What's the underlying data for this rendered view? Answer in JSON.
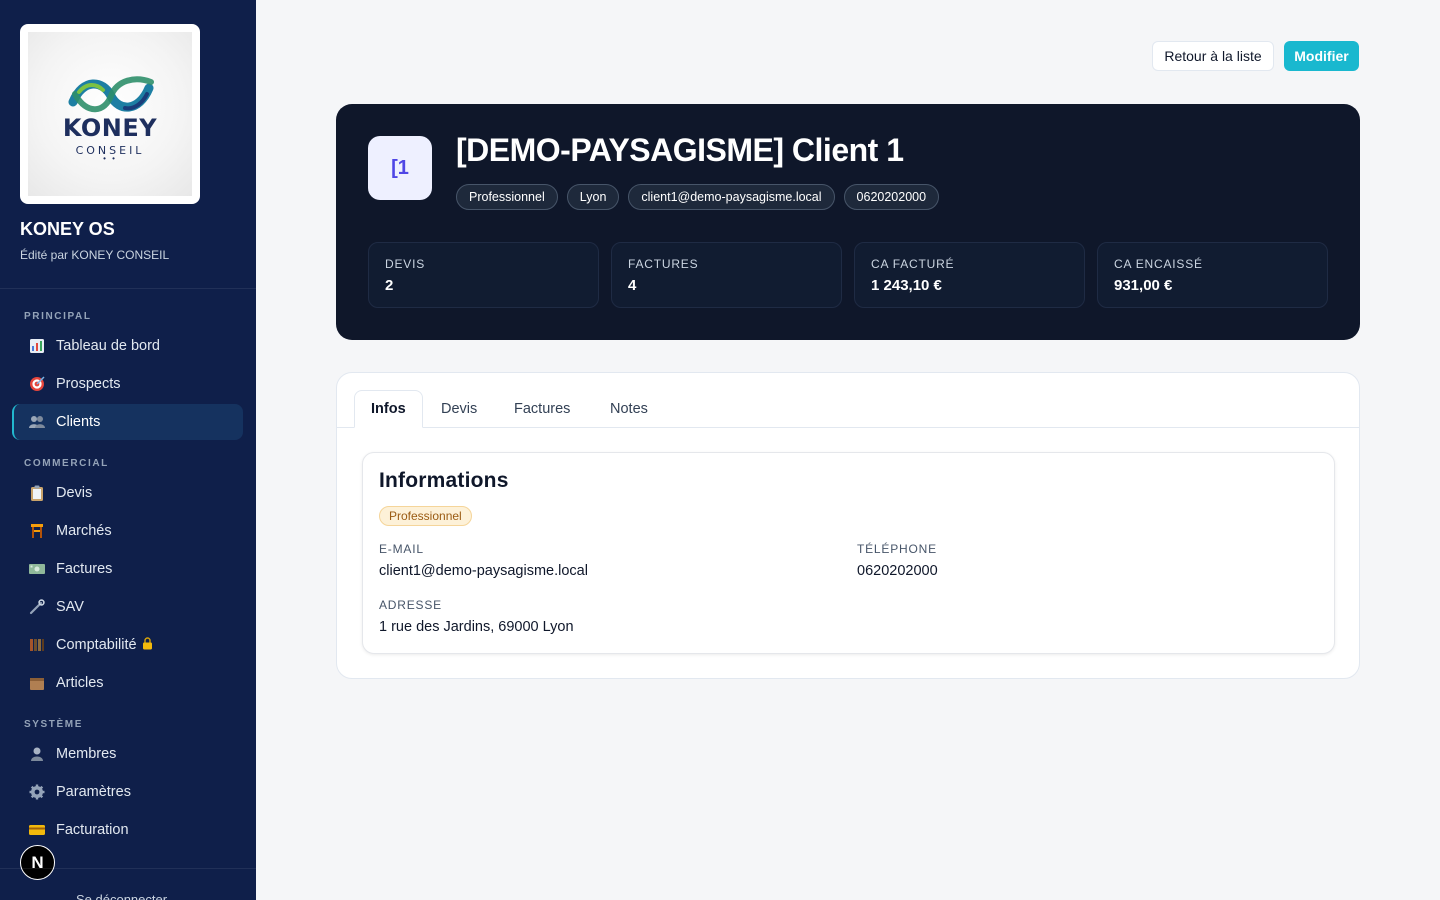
{
  "sidebar": {
    "logo": {
      "word": "KONEY",
      "sub": "CONSEIL"
    },
    "brand_title": "KONEY OS",
    "brand_sub": "Édité par KONEY CONSEIL",
    "sections": {
      "principal": "PRINCIPAL",
      "commercial": "COMMERCIAL",
      "systeme": "SYSTÈME"
    },
    "items": {
      "tableau": {
        "label": "Tableau de bord",
        "icon": "bar-chart-icon"
      },
      "prospects": {
        "label": "Prospects",
        "icon": "target-icon"
      },
      "clients": {
        "label": "Clients",
        "icon": "users-icon"
      },
      "devis": {
        "label": "Devis",
        "icon": "clipboard-icon"
      },
      "marches": {
        "label": "Marchés",
        "icon": "construction-icon"
      },
      "factures": {
        "label": "Factures",
        "icon": "money-icon"
      },
      "sav": {
        "label": "SAV",
        "icon": "wrench-icon"
      },
      "comptabilite": {
        "label": "Comptabilité",
        "icon": "books-icon"
      },
      "articles": {
        "label": "Articles",
        "icon": "box-icon"
      },
      "membres": {
        "label": "Membres",
        "icon": "user-icon"
      },
      "parametres": {
        "label": "Paramètres",
        "icon": "gear-icon"
      },
      "facturation": {
        "label": "Facturation",
        "icon": "credit-card-icon"
      }
    },
    "n_badge": "N",
    "logout": "Se déconnecter"
  },
  "actions": {
    "back": "Retour à la liste",
    "edit": "Modifier"
  },
  "client": {
    "avatar": "[1",
    "title": "[DEMO-PAYSAGISME] Client 1",
    "chips": {
      "type": "Professionnel",
      "city": "Lyon",
      "email": "client1@demo-paysagisme.local",
      "phone": "0620202000"
    },
    "stats": {
      "devis": {
        "label": "DEVIS",
        "value": "2"
      },
      "factures": {
        "label": "FACTURES",
        "value": "4"
      },
      "ca_facture": {
        "label": "CA FACTURÉ",
        "value": "1 243,10 €"
      },
      "ca_encaisse": {
        "label": "CA ENCAISSÉ",
        "value": "931,00 €"
      }
    }
  },
  "tabs": {
    "infos": "Infos",
    "devis": "Devis",
    "factures": "Factures",
    "notes": "Notes"
  },
  "informations": {
    "title": "Informations",
    "badge": "Professionnel",
    "email_label": "E-MAIL",
    "email_value": "client1@demo-paysagisme.local",
    "phone_label": "TÉLÉPHONE",
    "phone_value": "0620202000",
    "address_label": "ADRESSE",
    "address_value": "1 rue des Jardins, 69000 Lyon"
  },
  "colors": {
    "sidebar_bg": "#0f1f4a",
    "accent": "#19b8cf",
    "hero_bg": "#0f172a"
  }
}
